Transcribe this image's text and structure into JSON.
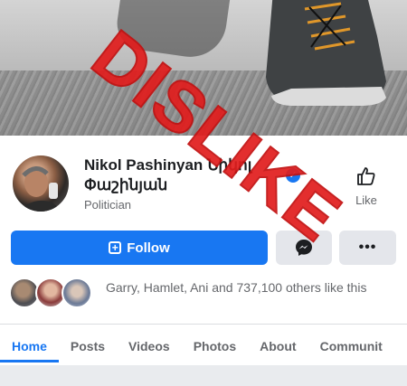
{
  "cover": {
    "alt_description": ""
  },
  "profile": {
    "name_line1": "Nikol Pashinyan Նիկոլ",
    "name_line2": "Փաշինյան",
    "category": "Politician",
    "verified": true
  },
  "like_button": {
    "label": "Like",
    "icon": "thumbs-up-icon"
  },
  "actions": {
    "follow_label": "Follow",
    "follow_icon": "follow-icon",
    "message_icon": "messenger-icon",
    "more_label": "•••"
  },
  "friends_like": {
    "text": "Garry, Hamlet, Ani and 737,100 others like this"
  },
  "tabs": [
    {
      "label": "Home",
      "active": true
    },
    {
      "label": "Posts",
      "active": false
    },
    {
      "label": "Videos",
      "active": false
    },
    {
      "label": "Photos",
      "active": false
    },
    {
      "label": "About",
      "active": false
    },
    {
      "label": "Communit",
      "active": false
    }
  ],
  "overlay": {
    "stamp_text": "DISLIKE"
  },
  "colors": {
    "accent": "#1877f2",
    "stamp": "#e11d1d"
  }
}
